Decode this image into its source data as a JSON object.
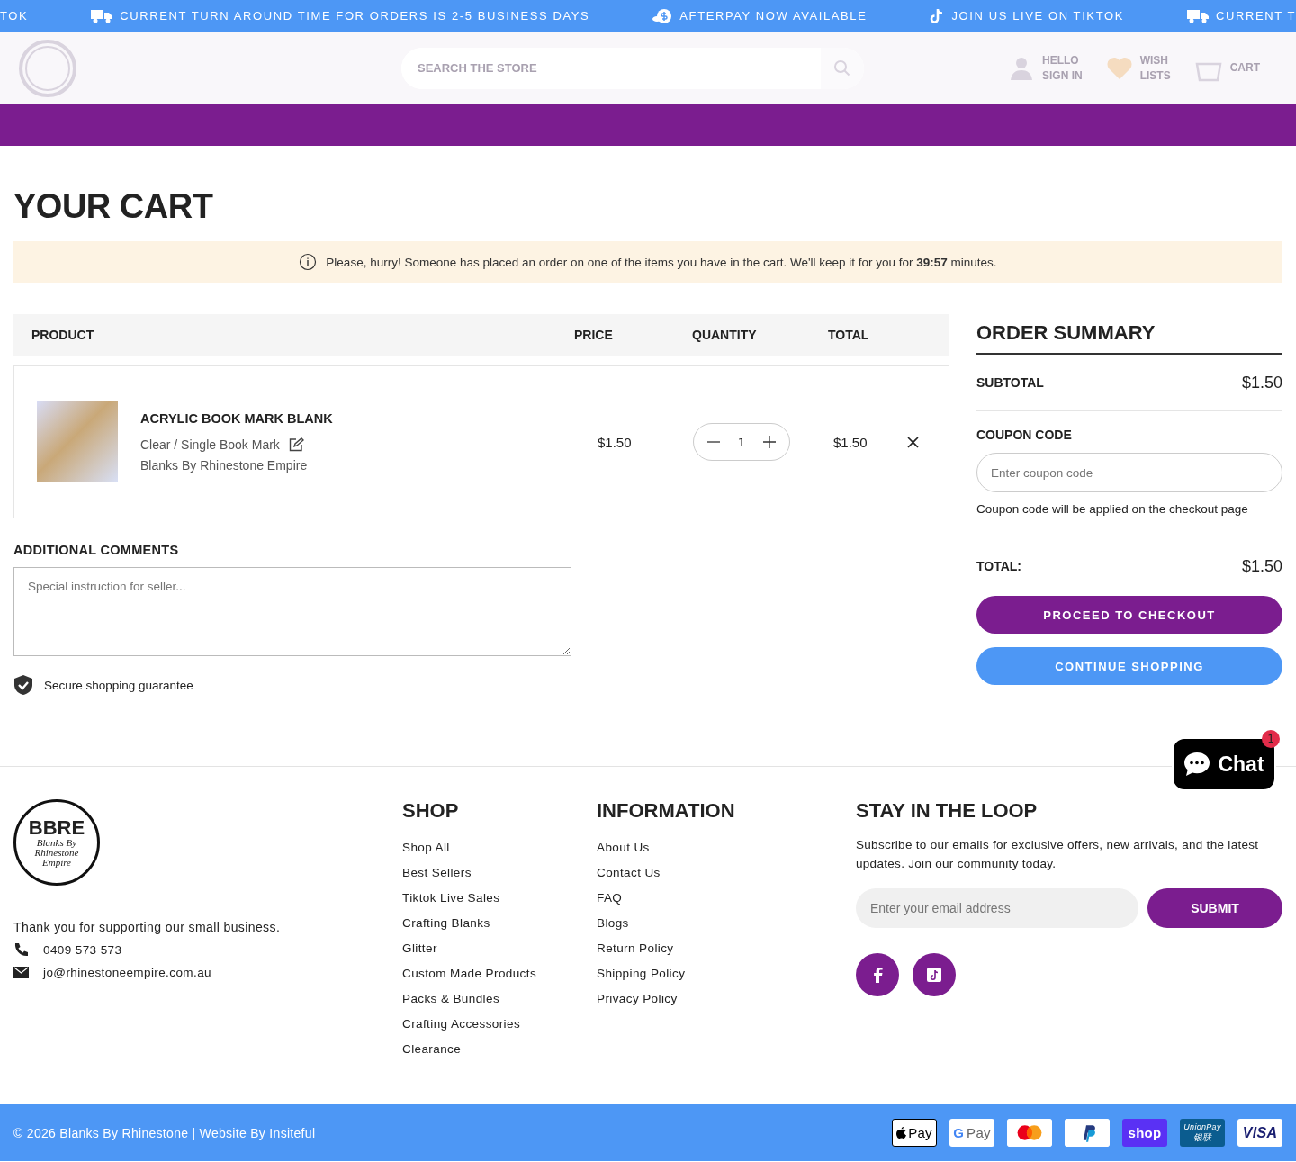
{
  "announcements": [
    {
      "kind": "none",
      "text": "TOK"
    },
    {
      "kind": "truck",
      "text": "CURRENT TURN AROUND TIME FOR ORDERS IS 2-5 BUSINESS DAYS"
    },
    {
      "kind": "money",
      "text": "AFTERPAY NOW AVAILABLE"
    },
    {
      "kind": "tiktok",
      "text": "JOIN US LIVE ON TIKTOK"
    },
    {
      "kind": "truck",
      "text": "CURRENT T"
    }
  ],
  "header": {
    "search": {
      "placeholder": "SEARCH THE STORE"
    },
    "account": [
      "HELLO",
      "SIGN IN"
    ],
    "wishlist": [
      "WISH",
      "LISTS"
    ],
    "cart": "CART"
  },
  "page_title": "YOUR CART",
  "notice": {
    "text": "Please, hurry! Someone has placed an order on one of the items you have in the cart. We'll keep it for you for **39:57** minutes."
  },
  "table": {
    "columns": [
      "PRODUCT",
      "PRICE",
      "QUANTITY",
      "TOTAL"
    ],
    "rows": [
      {
        "name": "ACRYLIC BOOK MARK BLANK",
        "variant": "Clear / Single Book Mark",
        "vendor": "Blanks By Rhinestone Empire",
        "price": "$1.50",
        "quantity": "1",
        "total": "$1.50"
      }
    ]
  },
  "comments": {
    "title": "ADDITIONAL COMMENTS",
    "placeholder": "Special instruction for seller..."
  },
  "secure": "Secure shopping guarantee",
  "summary": {
    "title": "ORDER SUMMARY",
    "subtotal_label": "SUBTOTAL",
    "subtotal": "$1.50",
    "coupon_label": "COUPON CODE",
    "coupon_placeholder": "Enter coupon code",
    "coupon_note": "Coupon code will be applied on the checkout page",
    "total_label": "TOTAL:",
    "total": "$1.50",
    "checkout": "PROCEED TO CHECKOUT",
    "continue": "CONTINUE SHOPPING"
  },
  "chat": {
    "label": "Chat",
    "badge": "1"
  },
  "footer": {
    "logo": {
      "mark": "BBRE",
      "lines": [
        "Blanks By",
        "Rhinestone",
        "Empire"
      ]
    },
    "thanks": "Thank you for supporting our small business.",
    "phone": "0409 573 573",
    "email": "jo@rhinestoneempire.com.au",
    "columns": [
      {
        "title": "SHOP",
        "links": [
          "Shop All",
          "Best Sellers",
          "Tiktok Live Sales",
          "Crafting Blanks",
          "Glitter",
          "Custom Made Products",
          "Packs & Bundles",
          "Crafting Accessories",
          "Clearance"
        ]
      },
      {
        "title": "INFORMATION",
        "links": [
          "About Us",
          "Contact Us",
          "FAQ",
          "Blogs",
          "Return Policy",
          "Shipping Policy",
          "Privacy Policy"
        ]
      }
    ],
    "newsletter": {
      "title": "STAY IN THE LOOP",
      "text": "Subscribe to our emails for exclusive offers, new arrivals, and the latest updates. Join our community today.",
      "placeholder": "Enter your email address",
      "button": "SUBMIT"
    },
    "social": [
      {
        "kind": "facebook"
      },
      {
        "kind": "tiktok"
      }
    ],
    "copyright": "© 2026 Blanks By Rhinestone | Website By Insiteful",
    "payments": [
      {
        "kind": "applepay",
        "label": "Pay"
      },
      {
        "kind": "googlepay",
        "mark": "G",
        "label": "Pay"
      },
      {
        "kind": "mastercard"
      },
      {
        "kind": "paypal"
      },
      {
        "kind": "shop",
        "label": "shop"
      },
      {
        "kind": "unionpay",
        "label": "UnionPay",
        "sub": "银联"
      },
      {
        "kind": "visa",
        "label": "VISA"
      }
    ]
  }
}
